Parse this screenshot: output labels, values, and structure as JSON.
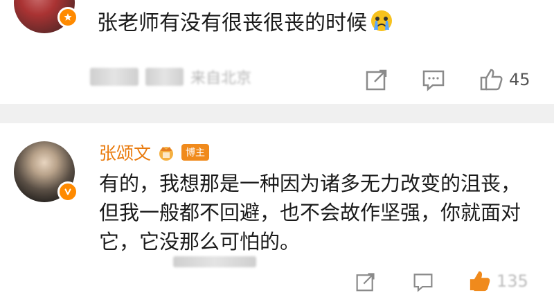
{
  "top_comment": {
    "text": "张老师有没有很丧很丧的时候",
    "emoji": "crying-face",
    "meta": "来自北京",
    "likes": "45"
  },
  "reply": {
    "author": "张颂文",
    "tag": "博主",
    "text": "有的，我想那是一种因为诸多无力改变的沮丧，但我一般都不回避，也不会故作坚强，你就面对它，它没那么可怕的。",
    "likes": "135"
  },
  "colors": {
    "accent": "#e97a0c",
    "badge": "#ff8a00",
    "separator": "#f0f0f0",
    "icon": "#8a8a8a"
  }
}
